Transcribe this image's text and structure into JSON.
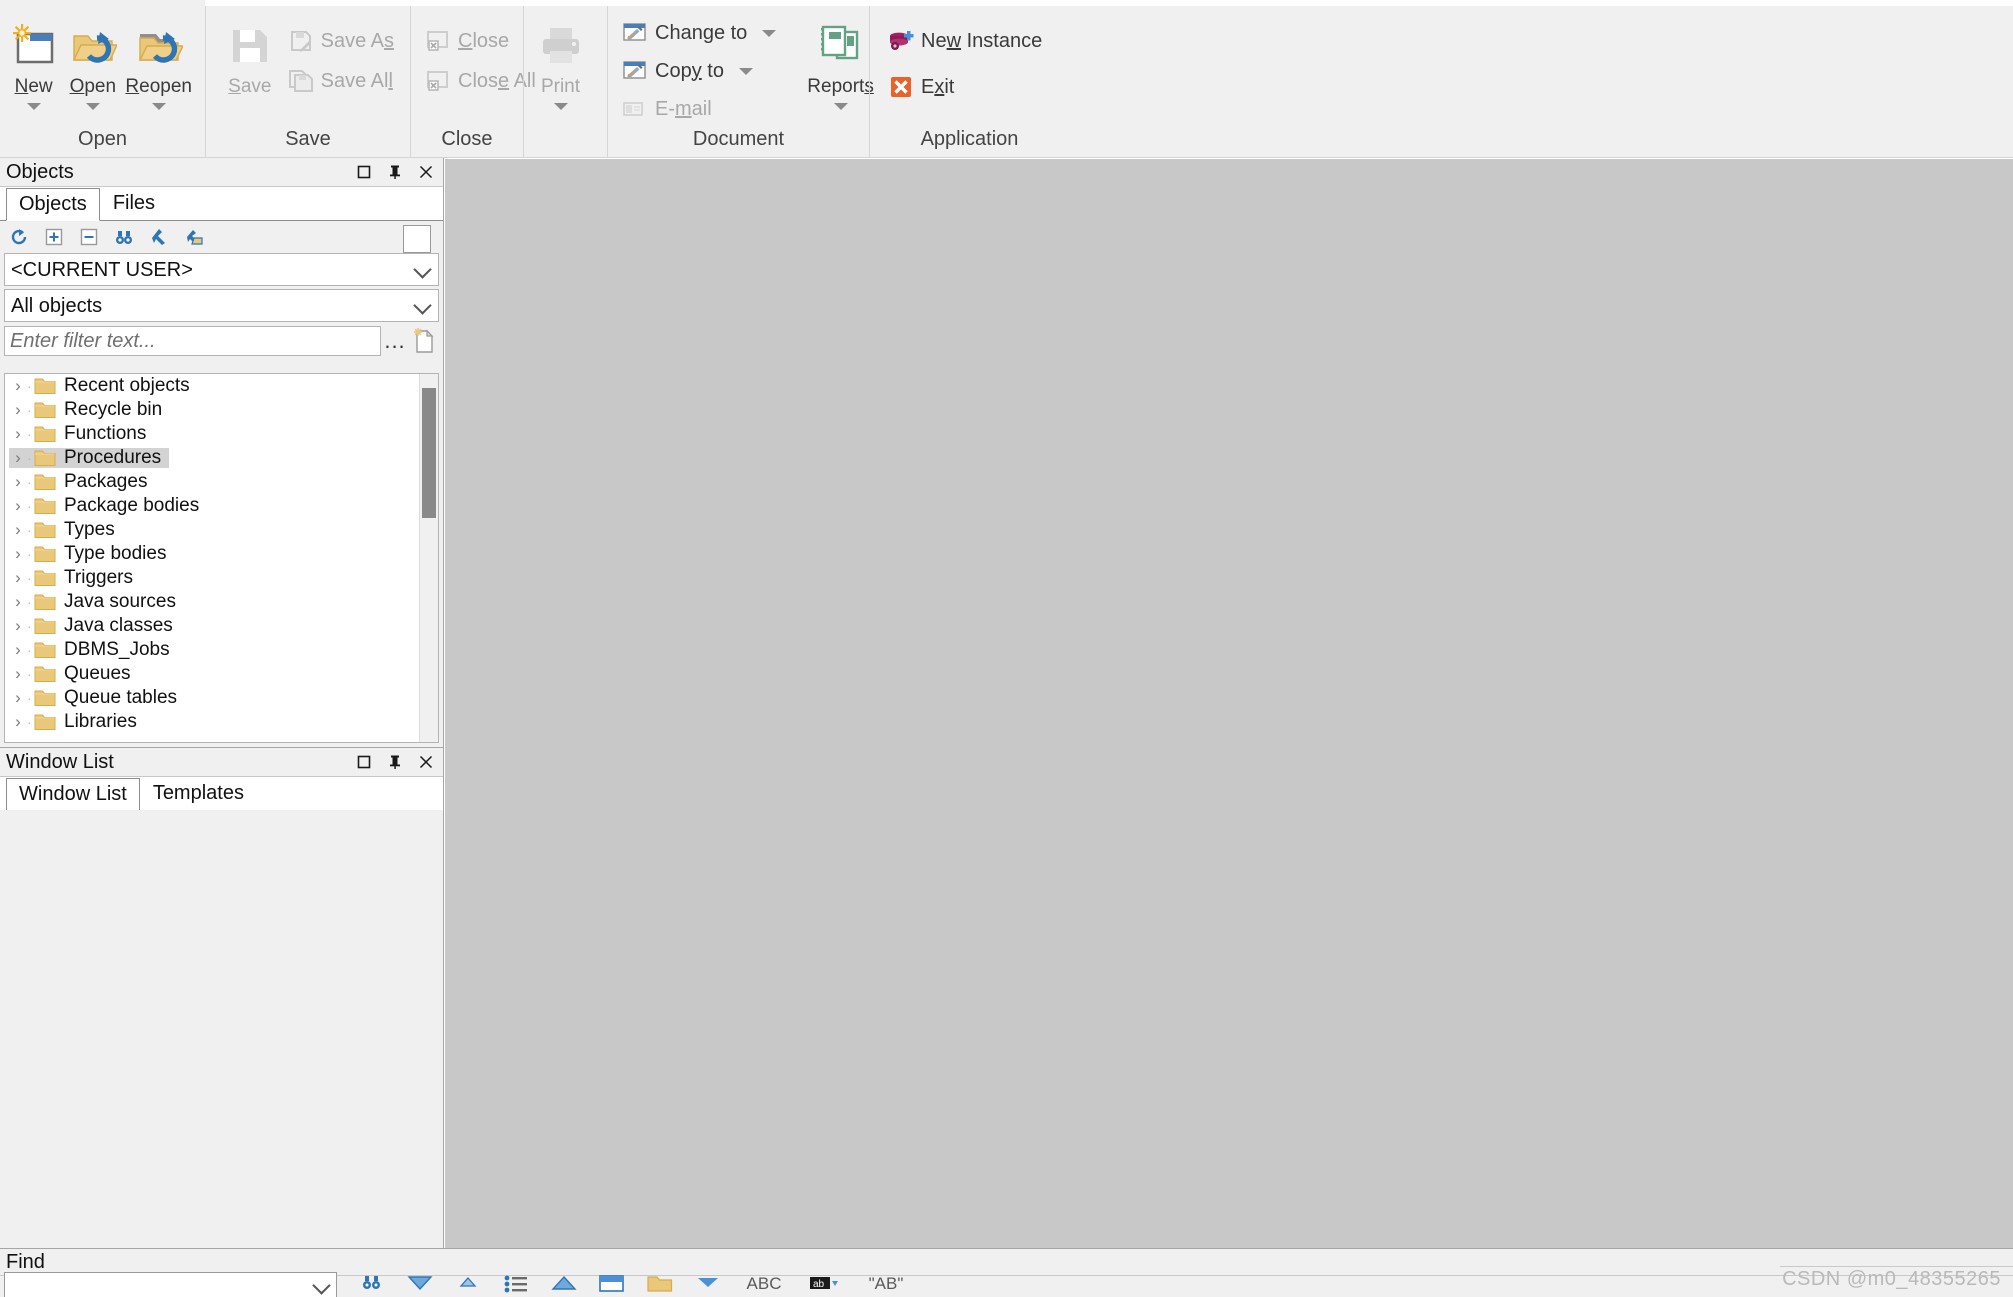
{
  "ribbon": {
    "groups": [
      {
        "name": "open",
        "label": "Open",
        "buttons": [
          {
            "id": "new",
            "label": "New",
            "accel": "N",
            "icon": "new-document-icon",
            "has_arrow": true,
            "disabled": false
          },
          {
            "id": "open",
            "label": "Open",
            "accel": "O",
            "icon": "open-folder-icon",
            "has_arrow": true,
            "disabled": false
          },
          {
            "id": "reopen",
            "label": "Reopen",
            "accel": "R",
            "icon": "reopen-folder-icon",
            "has_arrow": true,
            "disabled": false
          }
        ]
      },
      {
        "name": "save",
        "label": "Save",
        "big": {
          "id": "save",
          "label": "Save",
          "accel": "S",
          "icon": "floppy-disk-icon",
          "disabled": true
        },
        "small": [
          {
            "id": "save-as",
            "label": "Save As",
            "accel": "A",
            "icon": "save-as-icon",
            "disabled": true
          },
          {
            "id": "save-all",
            "label": "Save All",
            "accel": "l",
            "icon": "save-all-icon",
            "disabled": true
          }
        ]
      },
      {
        "name": "close",
        "label": "Close",
        "small": [
          {
            "id": "close",
            "label": "Close",
            "accel": "C",
            "icon": "close-window-icon",
            "disabled": true
          },
          {
            "id": "close-all",
            "label": "Close All",
            "accel": "e",
            "icon": "close-all-windows-icon",
            "disabled": true
          }
        ]
      },
      {
        "name": "print",
        "label": "",
        "big": {
          "id": "print",
          "label": "Print",
          "icon": "printer-icon",
          "has_arrow": true,
          "disabled": true
        }
      },
      {
        "name": "document",
        "label": "Document",
        "small": [
          {
            "id": "change-to",
            "label": "Change to",
            "accel": "g",
            "icon": "change-to-icon",
            "has_caret": true,
            "disabled": false
          },
          {
            "id": "copy-to",
            "label": "Copy to",
            "accel": "y",
            "icon": "copy-to-icon",
            "has_caret": true,
            "disabled": false
          },
          {
            "id": "email",
            "label": "E-mail",
            "accel": "m",
            "icon": "email-icon",
            "disabled": true
          }
        ],
        "big": {
          "id": "reports",
          "label": "Reports",
          "accel": "s",
          "icon": "reports-book-icon",
          "has_arrow": true,
          "disabled": false
        }
      },
      {
        "name": "application",
        "label": "Application",
        "small": [
          {
            "id": "new-instance",
            "label": "New Instance",
            "accel": "w",
            "icon": "new-instance-database-icon",
            "disabled": false
          },
          {
            "id": "exit",
            "label": "Exit",
            "accel": "x",
            "icon": "exit-x-icon",
            "disabled": false
          }
        ]
      }
    ]
  },
  "objects_panel": {
    "caption": "Objects",
    "caption_buttons": [
      {
        "id": "maximize",
        "icon": "maximize-square-icon"
      },
      {
        "id": "pin",
        "icon": "push-pin-icon"
      },
      {
        "id": "close",
        "icon": "close-x-icon"
      }
    ],
    "tabs": [
      {
        "id": "objects",
        "label": "Objects",
        "active": true
      },
      {
        "id": "files",
        "label": "Files",
        "active": false
      }
    ],
    "toolbar": [
      {
        "id": "refresh",
        "icon": "refresh-circular-arrow-icon"
      },
      {
        "id": "expand-all",
        "icon": "plus-box-icon"
      },
      {
        "id": "collapse-all",
        "icon": "minus-box-icon"
      },
      {
        "id": "find",
        "icon": "binoculars-icon"
      },
      {
        "id": "select-object",
        "icon": "arrow-pointer-icon"
      },
      {
        "id": "open-folder",
        "icon": "arrow-folder-icon"
      }
    ],
    "user_combo": {
      "value": "<CURRENT USER>"
    },
    "type_combo": {
      "value": "All objects"
    },
    "filter": {
      "placeholder": "Enter filter text...",
      "value": "",
      "ellipsis_label": "...",
      "new_filter_icon": "new-filter-document-icon"
    },
    "tree": [
      {
        "label": "Recent objects",
        "selected": false
      },
      {
        "label": "Recycle bin",
        "selected": false
      },
      {
        "label": "Functions",
        "selected": false
      },
      {
        "label": "Procedures",
        "selected": true
      },
      {
        "label": "Packages",
        "selected": false
      },
      {
        "label": "Package bodies",
        "selected": false
      },
      {
        "label": "Types",
        "selected": false
      },
      {
        "label": "Type bodies",
        "selected": false
      },
      {
        "label": "Triggers",
        "selected": false
      },
      {
        "label": "Java sources",
        "selected": false
      },
      {
        "label": "Java classes",
        "selected": false
      },
      {
        "label": "DBMS_Jobs",
        "selected": false
      },
      {
        "label": "Queues",
        "selected": false
      },
      {
        "label": "Queue tables",
        "selected": false
      },
      {
        "label": "Libraries",
        "selected": false
      }
    ]
  },
  "window_list_panel": {
    "caption": "Window List",
    "caption_buttons": [
      {
        "id": "maximize",
        "icon": "maximize-square-icon"
      },
      {
        "id": "pin",
        "icon": "push-pin-icon"
      },
      {
        "id": "close",
        "icon": "close-x-icon"
      }
    ],
    "tabs": [
      {
        "id": "window-list",
        "label": "Window List",
        "active": true
      },
      {
        "id": "templates",
        "label": "Templates",
        "active": false
      }
    ]
  },
  "find_bar": {
    "caption": "Find",
    "input": {
      "value": "",
      "placeholder": ""
    },
    "tools": [
      {
        "id": "find-objects",
        "icon": "binoculars-icon"
      },
      {
        "id": "filter-down",
        "icon": "triangle-down-icon"
      },
      {
        "id": "filter-up",
        "icon": "triangle-up-small-icon"
      },
      {
        "id": "list-items",
        "icon": "bullet-list-icon"
      },
      {
        "id": "sort-up",
        "icon": "triangle-up-icon"
      },
      {
        "id": "window-icon",
        "icon": "window-blue-icon"
      },
      {
        "id": "folder-icon",
        "icon": "folder-yellow-icon"
      },
      {
        "id": "dropdown-blue",
        "icon": "triangle-down-blue-icon"
      },
      {
        "id": "abc-case",
        "icon": "abc-text-icon"
      },
      {
        "id": "bold-toggle",
        "icon": "bold-black-icon"
      },
      {
        "id": "quoted-ab",
        "icon": "quoted-ab-icon"
      }
    ]
  },
  "watermark": {
    "text": "CSDN @m0_48355265"
  },
  "colors": {
    "ribbon_bg": "#f0f0f0",
    "workspace_bg": "#c8c8c8",
    "folder_yellow": "#eac87a",
    "accent_blue": "#2e75b6",
    "selection_gray": "#d3d3d3",
    "reports_green": "#64a286",
    "exit_orange": "#e8622c",
    "instance_magenta": "#a02060"
  }
}
